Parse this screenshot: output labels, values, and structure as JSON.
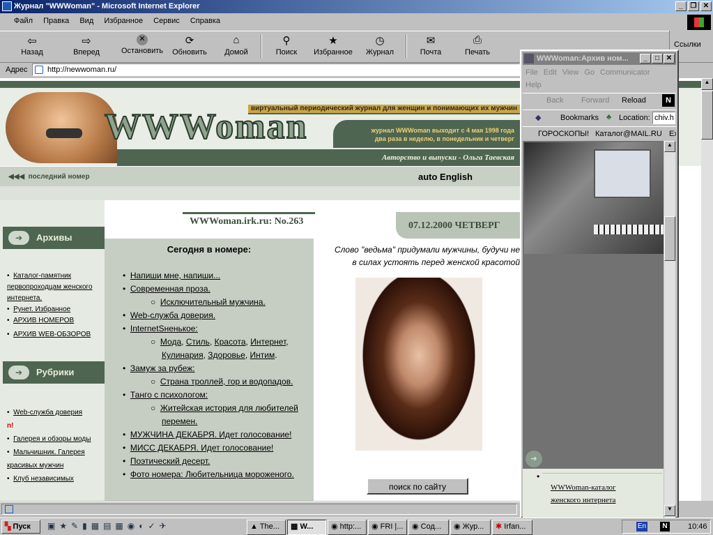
{
  "window": {
    "title": "Журнал \"WWWoman\" - Microsoft Internet Explorer"
  },
  "menu": [
    "Файл",
    "Правка",
    "Вид",
    "Избранное",
    "Сервис",
    "Справка"
  ],
  "toolbar": {
    "back": "Назад",
    "forward": "Вперед",
    "stop": "Остановить",
    "refresh": "Обновить",
    "home": "Домой",
    "search": "Поиск",
    "favorites": "Избранное",
    "history": "Журнал",
    "mail": "Почта",
    "print": "Печать",
    "links": "Ссылки"
  },
  "address": {
    "label": "Адрес",
    "value": "http://newwoman.ru/"
  },
  "site": {
    "logo": "WWWoman",
    "tagline": "виртуальный периодический журнал для женщин и понимающих их мужчин",
    "schedule1": "журнал WWWoman выходит с 4 мая 1998 года",
    "schedule2": "два раза в неделю, в понедельник и четверг",
    "author": "Авторство и выпуски - Ольга Таевская",
    "last_issue": "последний номер",
    "english": "auto English",
    "issue": "WWWoman.irk.ru: No.263",
    "date": "07.12.2000",
    "weekday": "ЧЕТВЕРГ",
    "archives_title": "Архивы",
    "archives": [
      "Каталог-памятник первопроходцам женского интернета.",
      "Рунет. Избранное",
      "АРХИВ НОМЕРОВ",
      "АРХИВ WEB-ОБЗОРОВ"
    ],
    "rubrics_title": "Рубрики",
    "rubrics": [
      "Web-служба доверия",
      "n!",
      "Галерея и обзоры моды",
      "Мальчишник. Галерея красивых мужчин",
      "Клуб независимых"
    ],
    "today_title": "Сегодня в номере:",
    "toc": {
      "item1": "Напиши мне, напиши...",
      "item2": "Современная проза.",
      "item2a": "Исключительный мужчина.",
      "item3": "Web-служба доверия.",
      "item4": "InternetSненькое:",
      "item4a": [
        "Мода",
        "Стиль",
        "Красота",
        "Интернет",
        "Кулинария",
        "Здоровье",
        "Интим"
      ],
      "item5": "Замуж за рубеж:",
      "item5a": "Страна троллей, гор и водопадов.",
      "item6": "Танго с психологом:",
      "item6a": "Житейская история для любителей перемен.",
      "item7": "МУЖЧИНА ДЕКАБРЯ. Идет голосование!",
      "item8": "МИСС ДЕКАБРЯ. Идет голосование!",
      "item9": "Поэтический десерт.",
      "item10": "Фото номера: Любительница мороженого."
    },
    "quote1": "Слово \"ведьма\" придумали мужчины, будучи не",
    "quote2": "в силах устоять перед женской красотой",
    "search_btn": "поиск по сайту"
  },
  "popup": {
    "title": "WWWoman:Архив ном...",
    "menu": [
      "File",
      "Edit",
      "View",
      "Go",
      "Communicator",
      "Help"
    ],
    "back": "Back",
    "forward": "Forward",
    "reload": "Reload",
    "bookmarks": "Bookmarks",
    "location_label": "Location:",
    "location_value": "chiv.h",
    "links": [
      "ГОРОСКОПЫ!",
      "Каталог@MAIL.RU",
      "Ex"
    ],
    "link_text": "WWWoman-каталог женского интернета"
  },
  "taskbar": {
    "start": "Пуск",
    "tasks": [
      "The...",
      "W...",
      "http:...",
      "FRI |...",
      "Сод...",
      "Жур...",
      "Irfan..."
    ],
    "lang": "En",
    "clock": "10:46"
  }
}
